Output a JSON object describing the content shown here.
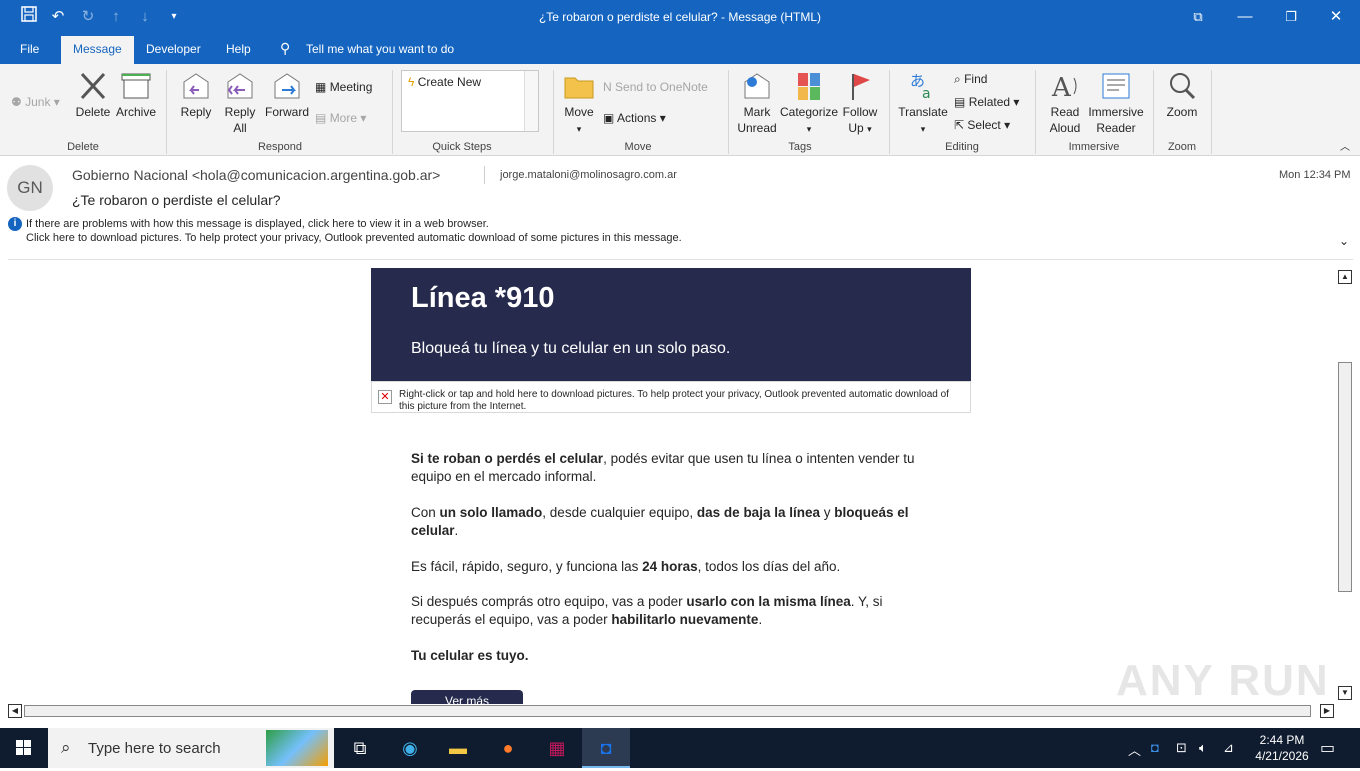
{
  "window": {
    "title": "¿Te robaron o perdiste el celular?  -  Message (HTML)"
  },
  "menu": {
    "items": [
      "File",
      "Message",
      "Developer",
      "Help"
    ],
    "tell_me": "Tell me what you want to do"
  },
  "ribbon": {
    "junk": "Junk",
    "delete": "Delete",
    "archive": "Archive",
    "group_delete": "Delete",
    "reply": "Reply",
    "reply_all_1": "Reply",
    "reply_all_2": "All",
    "forward": "Forward",
    "meeting": "Meeting",
    "more": "More",
    "group_respond": "Respond",
    "quick_steps_item": "Create New",
    "group_quick_steps": "Quick Steps",
    "move": "Move",
    "send_onenote": "Send to OneNote",
    "actions": "Actions",
    "group_move": "Move",
    "mark_unread_1": "Mark",
    "mark_unread_2": "Unread",
    "categorize": "Categorize",
    "follow_up_1": "Follow",
    "follow_up_2": "Up",
    "group_tags": "Tags",
    "translate": "Translate",
    "find": "Find",
    "related": "Related",
    "select": "Select",
    "group_editing": "Editing",
    "read_aloud_1": "Read",
    "read_aloud_2": "Aloud",
    "immersive_1": "Immersive",
    "immersive_2": "Reader",
    "group_immersive": "Immersive",
    "zoom": "Zoom",
    "group_zoom": "Zoom"
  },
  "message": {
    "avatar_initials": "GN",
    "from": "Gobierno Nacional <hola@comunicacion.argentina.gob.ar>",
    "to": "jorge.mataloni@molinosagro.com.ar",
    "date": "Mon 12:34 PM",
    "subject": "¿Te robaron o perdiste el celular?",
    "info_line1": "If there are problems with how this message is displayed, click here to view it in a web browser.",
    "info_line2": "Click here to download pictures. To help protect your privacy, Outlook prevented automatic download of some pictures in this message."
  },
  "email": {
    "banner_title": "Línea *910",
    "banner_subtitle": "Bloqueá tu línea y tu celular en un solo paso.",
    "blocked_image_text": "Right-click or tap and hold here to download pictures. To help protect your privacy, Outlook prevented automatic download of this picture from the Internet.",
    "p1_bold": "Si te roban o perdés el celular",
    "p1_rest": ", podés evitar que usen tu línea o intenten vender tu equipo en el mercado informal.",
    "p2_a": "Con ",
    "p2_b": "un solo llamado",
    "p2_c": ", desde cualquier equipo, ",
    "p2_d": "das de baja la línea",
    "p2_e": " y ",
    "p2_f": "bloqueás el celular",
    "p2_g": ".",
    "p3_a": "Es fácil, rápido, seguro, y funciona las ",
    "p3_b": "24 horas",
    "p3_c": ", todos los días del año.",
    "p4_a": "Si después comprás otro equipo, vas a poder ",
    "p4_b": "usarlo con la misma línea",
    "p4_c": ". Y, si recuperás el equipo, vas a poder ",
    "p4_d": "habilitarlo nuevamente",
    "p4_e": ".",
    "p5": "Tu celular es tuyo.",
    "button": "Ver más"
  },
  "watermark": "ANY RUN",
  "taskbar": {
    "search_placeholder": "Type here to search",
    "time": "2:44 PM",
    "date": "4/21/2026"
  }
}
